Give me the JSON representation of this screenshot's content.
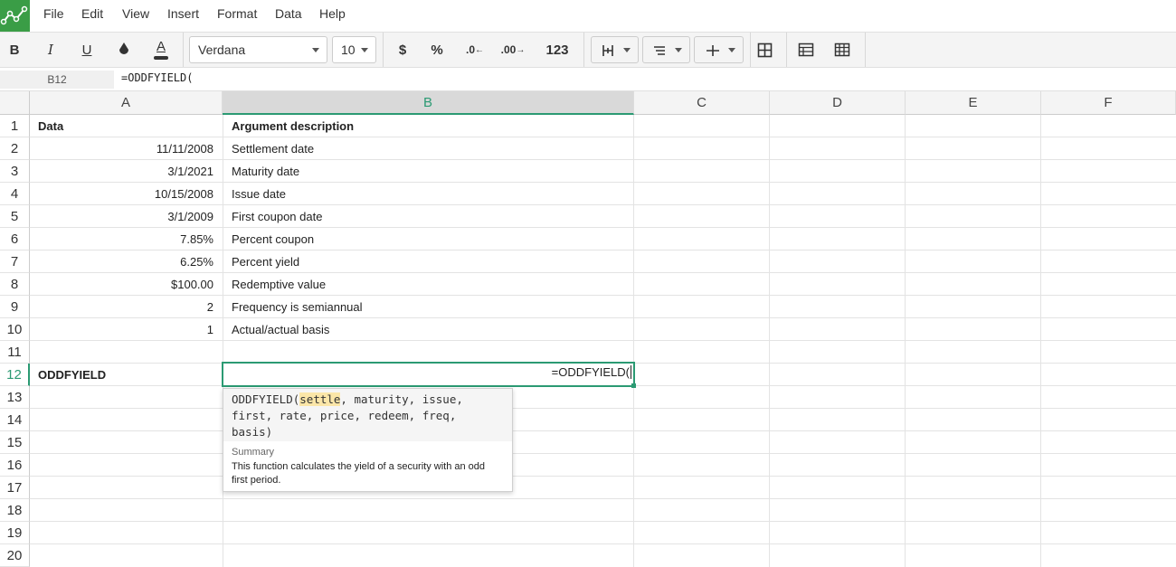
{
  "menu": [
    "File",
    "Edit",
    "View",
    "Insert",
    "Format",
    "Data",
    "Help"
  ],
  "toolbar": {
    "bold": "B",
    "italic": "I",
    "underline": "U",
    "font_family": "Verdana",
    "font_size": "10",
    "currency": "$",
    "percent": "%",
    "dec_decrease": ".0",
    "dec_increase": ".00",
    "number_format": "123"
  },
  "formula_bar": {
    "name_box": "B12",
    "formula": "=ODDFYIELD("
  },
  "columns": [
    "A",
    "B",
    "C",
    "D",
    "E",
    "F"
  ],
  "rows": [
    "1",
    "2",
    "3",
    "4",
    "5",
    "6",
    "7",
    "8",
    "9",
    "10",
    "11",
    "12",
    "13",
    "14",
    "15",
    "16",
    "17",
    "18",
    "19",
    "20"
  ],
  "cells": {
    "A1": "Data",
    "B1": "Argument description",
    "A2": "11/11/2008",
    "B2": "Settlement date",
    "A3": "3/1/2021",
    "B3": "Maturity date",
    "A4": "10/15/2008",
    "B4": "Issue date",
    "A5": "3/1/2009",
    "B5": "First coupon date",
    "A6": "7.85%",
    "B6": "Percent coupon",
    "A7": "6.25%",
    "B7": "Percent yield",
    "A8": "$100.00",
    "B8": "Redemptive value",
    "A9": "2",
    "B9": "Frequency is semiannual",
    "A10": "1",
    "B10": "Actual/actual basis",
    "A12": "ODDFYIELD",
    "B12": "=ODDFYIELD("
  },
  "autocomplete": {
    "fn": "ODDFYIELD(",
    "arg_active": "settle",
    "args_line1": ", maturity, issue,",
    "args_line2": "first, rate, price, redeem, freq,",
    "args_line3": "basis)",
    "label": "Summary",
    "description": "This function calculates the yield of a security with an odd first period."
  },
  "colors": {
    "accent": "#2b9a73",
    "logo": "#3a9d46"
  }
}
